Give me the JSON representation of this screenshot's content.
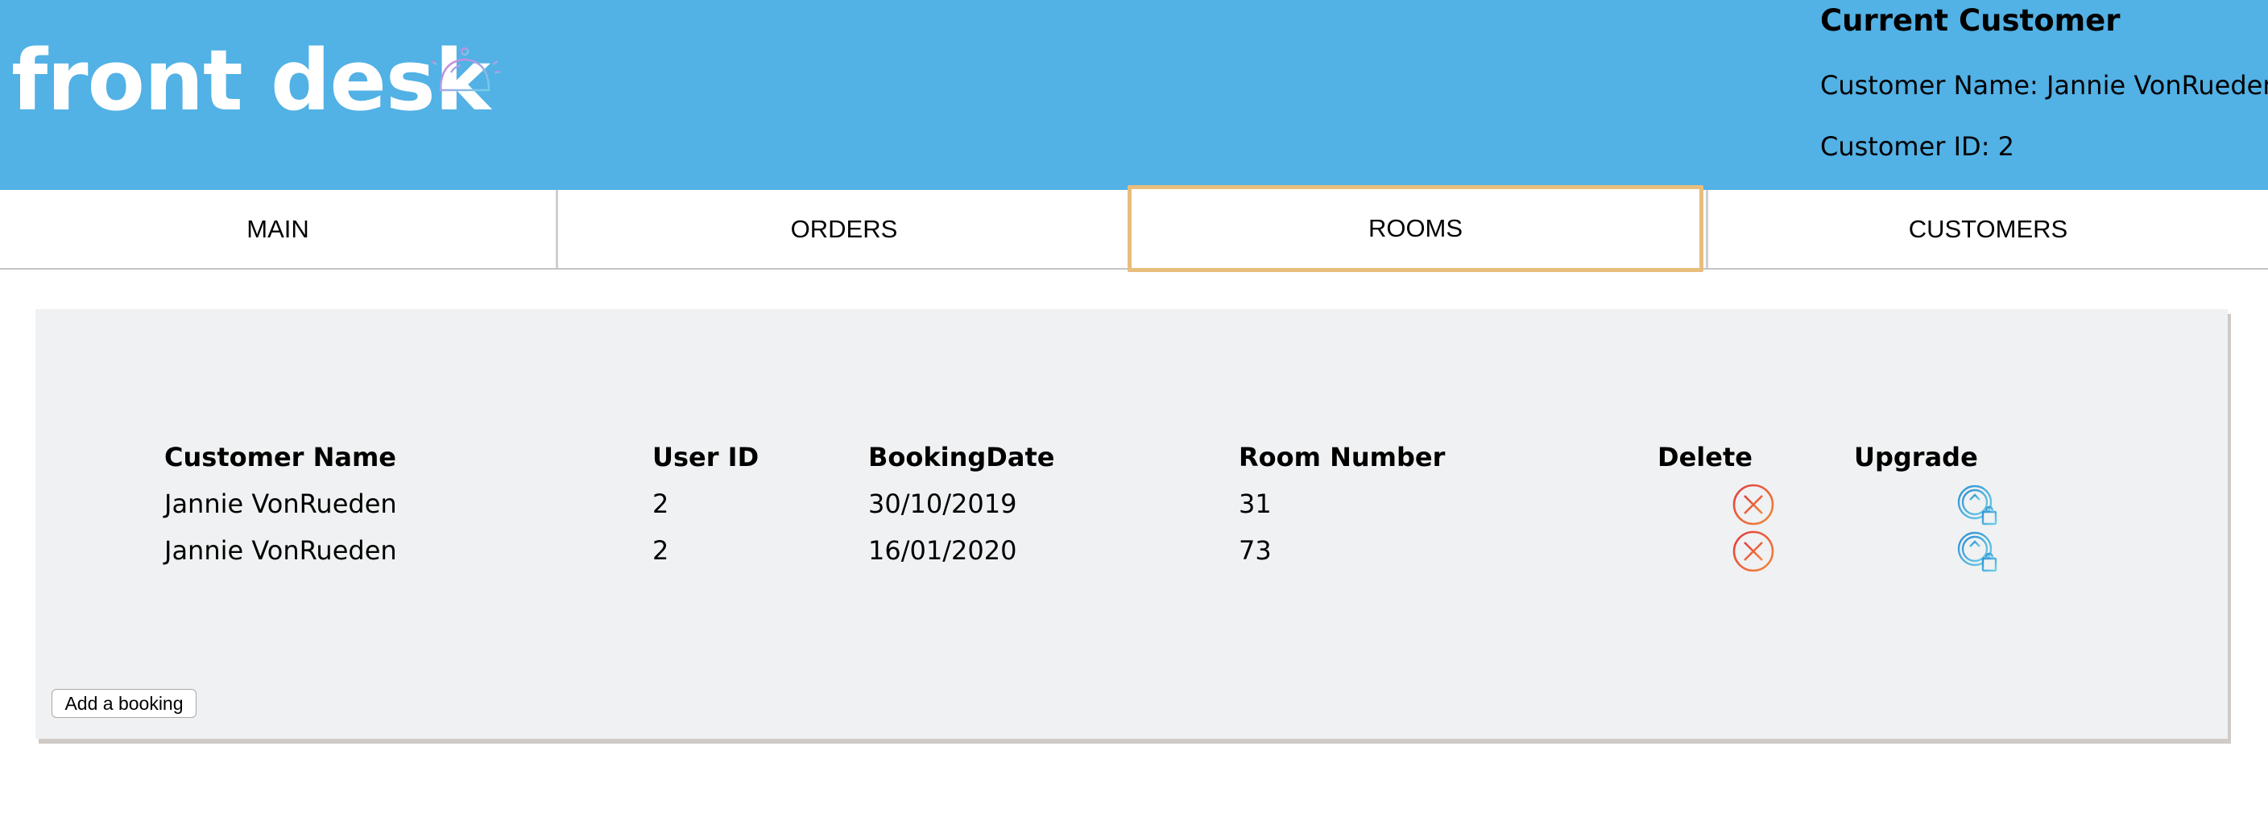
{
  "header": {
    "brand": "front desk",
    "bell_icon": "service-bell-icon",
    "current_customer": {
      "title": "Current Customer",
      "name_line": "Customer Name: Jannie VonRueden",
      "id_line": "Customer ID: 2"
    }
  },
  "tabs": [
    {
      "label": "MAIN"
    },
    {
      "label": "ORDERS"
    },
    {
      "label": "ROOMS",
      "active": true
    },
    {
      "label": "CUSTOMERS"
    }
  ],
  "table": {
    "headers": [
      "Customer Name",
      "User ID",
      "BookingDate",
      "Room Number",
      "Delete",
      "Upgrade"
    ],
    "rows": [
      {
        "customer_name": "Jannie VonRueden",
        "user_id": "2",
        "booking_date": "30/10/2019",
        "room_number": "31"
      },
      {
        "customer_name": "Jannie VonRueden",
        "user_id": "2",
        "booking_date": "16/01/2020",
        "room_number": "73"
      }
    ],
    "delete_icon": "delete-circle-x-icon",
    "upgrade_icon": "upgrade-arrow-bag-icon"
  },
  "add_button_label": "Add a booking",
  "colors": {
    "header_bg": "#52b1e5",
    "active_tab_border": "#e7bd7c",
    "panel_bg": "#f0f1f2",
    "delete_red": "#e0462f",
    "upgrade_blue": "#3ba8db"
  }
}
